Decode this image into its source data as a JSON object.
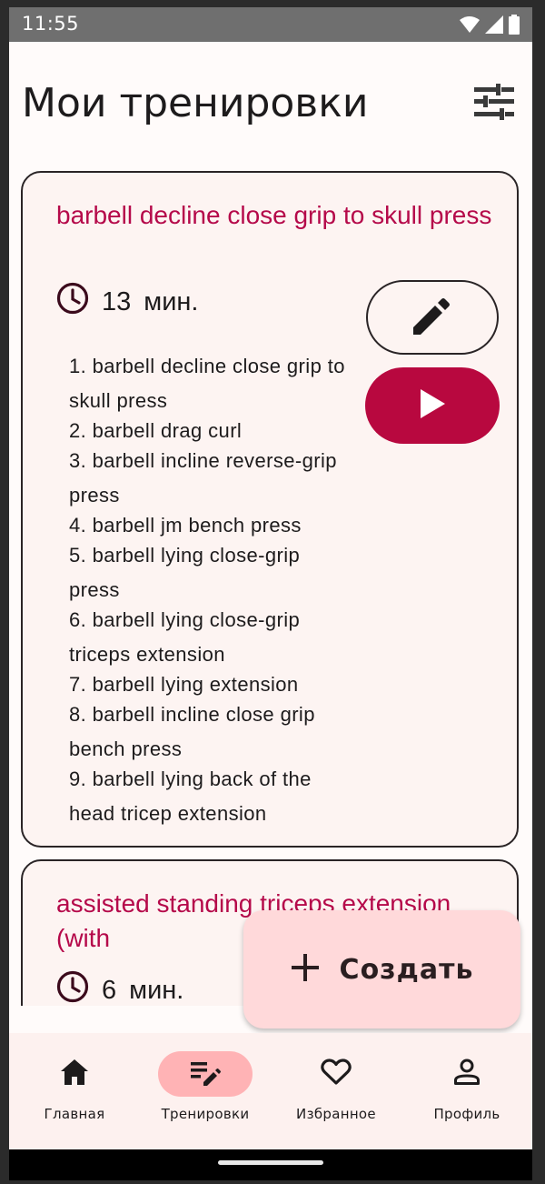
{
  "status_bar": {
    "time": "11:55",
    "icons": [
      "wifi-icon",
      "signal-icon",
      "battery-icon"
    ]
  },
  "header": {
    "title": "Мои тренировки",
    "filter_icon": "tune-icon"
  },
  "workouts": [
    {
      "title": "barbell decline close grip to skull press",
      "duration_value": "13",
      "duration_unit": "мин.",
      "exercises": [
        "1. barbell decline close grip to skull press",
        "2. barbell drag curl",
        "3. barbell incline reverse-grip press",
        "4. barbell jm bench press",
        "5. barbell lying close-grip press",
        "6. barbell lying close-grip triceps extension",
        "7. barbell lying extension",
        "8. barbell incline close grip bench press",
        "9. barbell lying back of the head tricep extension"
      ]
    },
    {
      "title": "assisted standing triceps extension (with",
      "duration_value": "6",
      "duration_unit": "мин."
    }
  ],
  "fab": {
    "label": "Создать",
    "icon": "plus-icon"
  },
  "bottom_nav": {
    "items": [
      {
        "label": "Главная",
        "icon": "home-icon",
        "active": false
      },
      {
        "label": "Тренировки",
        "icon": "edit-list-icon",
        "active": true
      },
      {
        "label": "Избранное",
        "icon": "heart-icon",
        "active": false
      },
      {
        "label": "Профиль",
        "icon": "person-icon",
        "active": false
      }
    ]
  },
  "colors": {
    "accent": "#b8083f",
    "title_accent": "#b5094a",
    "card_bg": "#fdf4f2",
    "fab_bg": "#ffd9da",
    "nav_active": "#ffb3b5"
  }
}
